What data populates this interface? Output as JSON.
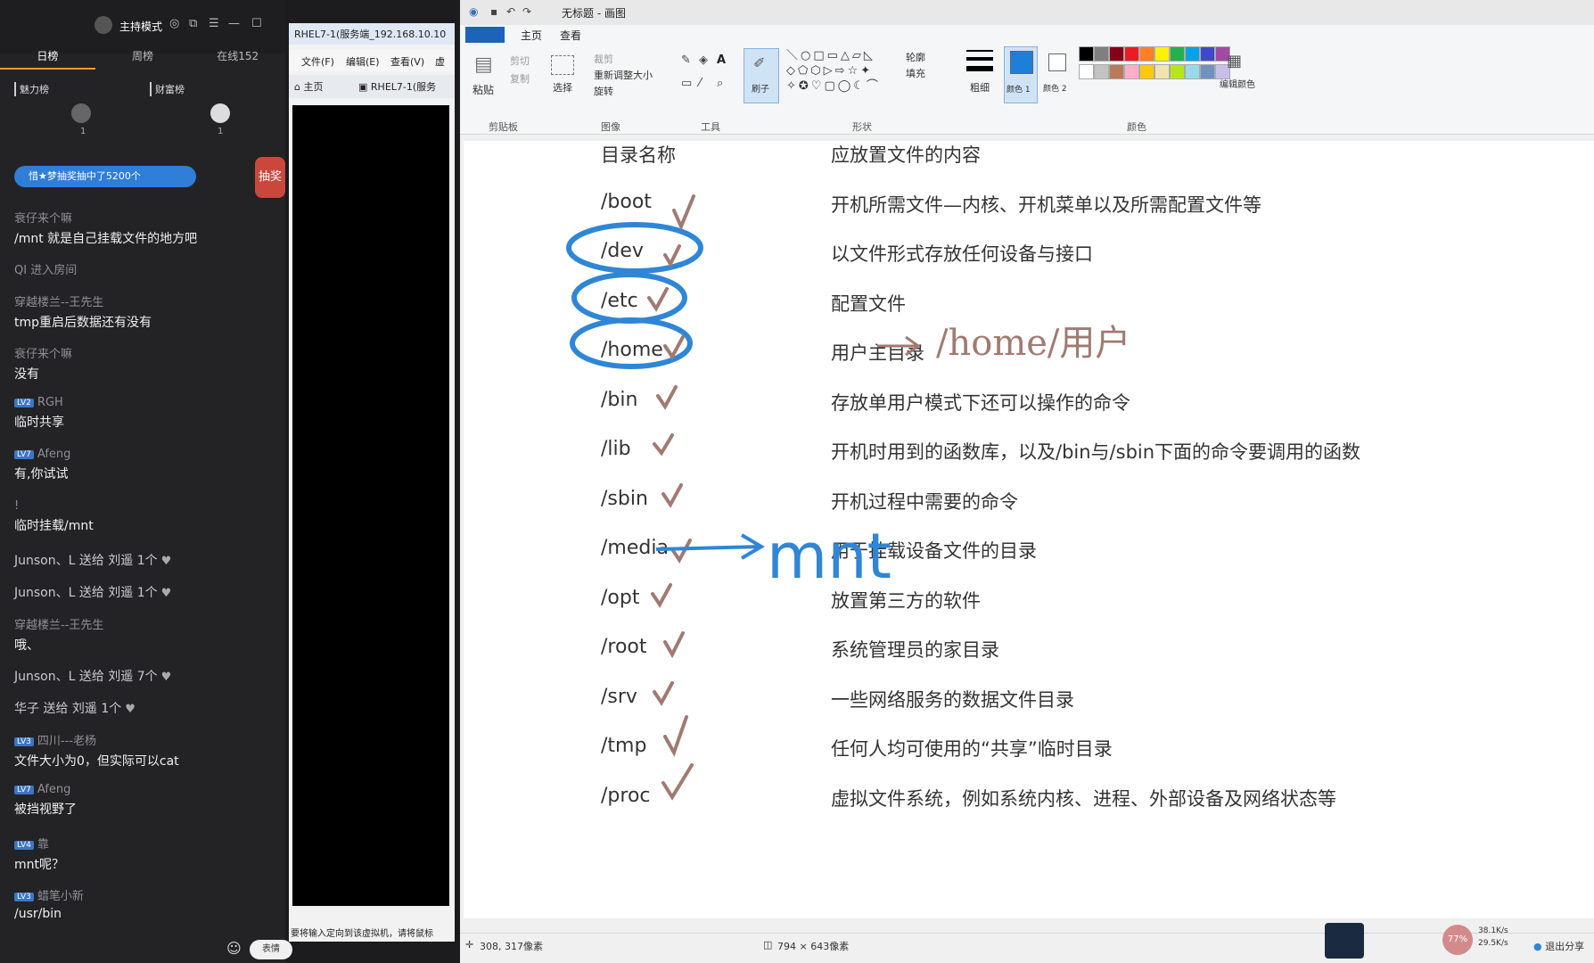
{
  "chat": {
    "header": {
      "mode": "主持模式"
    },
    "tabs": [
      "日榜",
      "周榜",
      "在线152"
    ],
    "rank_labels": [
      "魅力榜",
      "财富榜"
    ],
    "rank_nums": [
      "1",
      "1"
    ],
    "toast": "惜★梦抽奖抽中了5200个",
    "lottery": "抽奖",
    "messages": [
      {
        "user": "衰仔来个嘛",
        "text": "/mnt 就是自己挂载文件的地方吧"
      },
      {
        "system": "QI 进入房间"
      },
      {
        "user": "穿越楼兰--王先生",
        "text": "tmp重启后数据还有没有"
      },
      {
        "user": "衰仔来个嘛",
        "text": "没有"
      },
      {
        "lv": "LV2",
        "user": "RGH",
        "text": "临时共享"
      },
      {
        "lv": "LV7",
        "user": "Afeng",
        "text": "有,你试试"
      },
      {
        "user": "!",
        "text": "临时挂载/mnt"
      },
      {
        "gift": "Junson、L 送给 刘遥 1个"
      },
      {
        "gift": "Junson、L 送给 刘遥 1个"
      },
      {
        "user": "穿越楼兰--王先生",
        "text": "哦、"
      },
      {
        "gift": "Junson、L 送给 刘遥 7个"
      },
      {
        "gift": "华子 送给 刘遥 1个"
      },
      {
        "lv": "LV3",
        "user": "四川---老杨",
        "text": "文件大小为0，但实际可以cat"
      },
      {
        "lv": "LV7",
        "user": "Afeng",
        "text": "被挡视野了"
      },
      {
        "lv": "LV4",
        "user": "靠",
        "text": "mnt呢？"
      },
      {
        "lv": "LV3",
        "user": "蜡笔小新",
        "text": "/usr/bin"
      }
    ],
    "input_hint": "表情"
  },
  "vm": {
    "title": "RHEL7-1(服务端_192.168.10.10",
    "menu": [
      "文件(F)",
      "编辑(E)",
      "查看(V)",
      "虚"
    ],
    "tabs": [
      "主页",
      "RHEL7-1(服务"
    ],
    "status": "要将输入定向到该虚拟机，请将鼠标"
  },
  "paint": {
    "title": "无标题 - 画图",
    "ribbon_tabs": [
      "主页",
      "查看"
    ],
    "clipboard": {
      "paste": "粘贴",
      "cut": "剪切",
      "copy": "复制",
      "label": "剪贴板"
    },
    "image": {
      "select": "选择",
      "crop": "裁剪",
      "resize": "重新调整大小",
      "rotate": "旋转",
      "label": "图像"
    },
    "tools": {
      "label": "工具",
      "brush": "刷子"
    },
    "shapes": {
      "outline": "轮廓",
      "fill": "填充",
      "label": "形状"
    },
    "size": "粗细",
    "color1": "颜色 1",
    "color2": "颜色 2",
    "colors_label": "颜色",
    "edit_colors": "编辑颜色",
    "palette": [
      "#000000",
      "#7f7f7f",
      "#880015",
      "#ed1c24",
      "#ff7f27",
      "#fff200",
      "#22b14c",
      "#00a2e8",
      "#3f48cc",
      "#a349a4",
      "#ffffff",
      "#c3c3c3",
      "#b97a57",
      "#ffaec9",
      "#ffc90e",
      "#efe4b0",
      "#b5e61d",
      "#99d9ea",
      "#7092be",
      "#c8bfe7"
    ],
    "primary_color": "#1e7fd8",
    "status_pos": "308, 317像素",
    "status_size": "794 × 643像素",
    "net_up": "38.1K/s",
    "net_down": "29.5K/s",
    "cpu": "77%",
    "share": "退出分享",
    "table": {
      "header_name": "目录名称",
      "header_desc": "应放置文件的内容",
      "rows": [
        {
          "name": "/boot",
          "desc": "开机所需文件—内核、开机菜单以及所需配置文件等"
        },
        {
          "name": "/dev",
          "desc": "以文件形式存放任何设备与接口"
        },
        {
          "name": "/etc",
          "desc": "配置文件"
        },
        {
          "name": "/home",
          "desc": "用户主目录"
        },
        {
          "name": "/bin",
          "desc": "存放单用户模式下还可以操作的命令"
        },
        {
          "name": "/lib",
          "desc": "开机时用到的函数库，以及/bin与/sbin下面的命令要调用的函数"
        },
        {
          "name": "/sbin",
          "desc": "开机过程中需要的命令"
        },
        {
          "name": "/media",
          "desc": "用于挂载设备文件的目录"
        },
        {
          "name": "/opt",
          "desc": "放置第三方的软件"
        },
        {
          "name": "/root",
          "desc": "系统管理员的家目录"
        },
        {
          "name": "/srv",
          "desc": "一些网络服务的数据文件目录"
        },
        {
          "name": "/tmp",
          "desc": "任何人均可使用的“共享”临时目录"
        },
        {
          "name": "/proc",
          "desc": "虚拟文件系统，例如系统内核、进程、外部设备及网络状态等"
        }
      ]
    },
    "annotations": {
      "home_note": "/home/用户",
      "mnt_note": "mnt"
    }
  }
}
